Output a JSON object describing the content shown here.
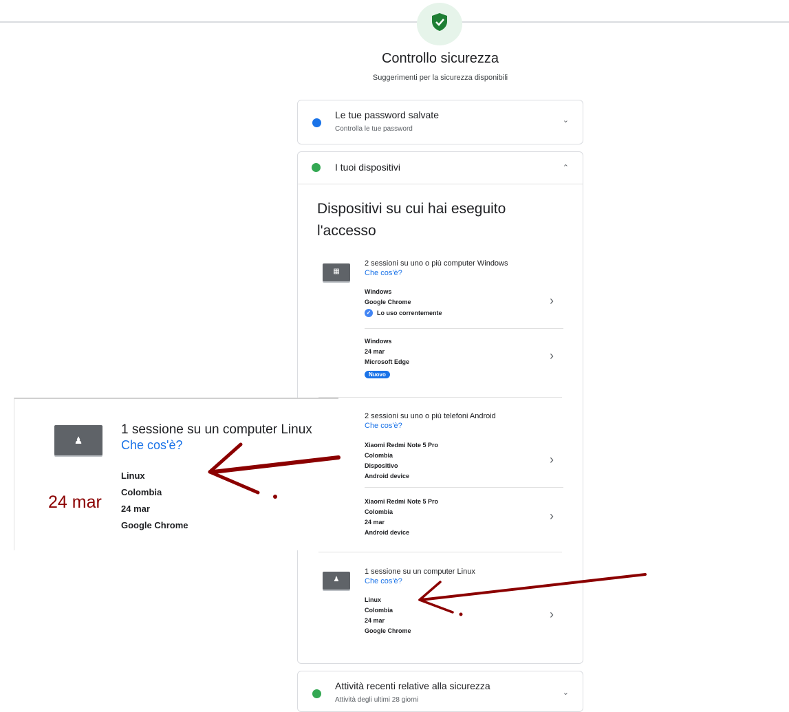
{
  "header": {
    "title": "Controllo sicurezza",
    "subtitle": "Suggerimenti per la sicurezza disponibili"
  },
  "colors": {
    "brand_blue": "#1a73e8",
    "success_green": "#34a853",
    "annotation_red": "#8b0000"
  },
  "passwords_card": {
    "title": "Le tue password salvate",
    "subtitle": "Controlla le tue password",
    "status_color": "#1a73e8",
    "chevron": "⌄"
  },
  "devices_card": {
    "title": "I tuoi dispositivi",
    "status_color": "#34a853",
    "chevron": "⌃",
    "section_title": "Dispositivi su cui hai eseguito l'accesso",
    "windows": {
      "icon": "windows-icon",
      "title": "2 sessioni su uno o più computer Windows",
      "link": "Che cos'è?",
      "sessions": [
        {
          "lines": [
            "Windows",
            "Google Chrome"
          ],
          "verified": "Lo uso correntemente"
        },
        {
          "lines": [
            "Windows",
            "24 mar",
            "Microsoft Edge"
          ],
          "badge": "Nuovo"
        }
      ]
    },
    "android": {
      "title": "2 sessioni su uno o più telefoni Android",
      "link": "Che cos'è?",
      "sessions": [
        {
          "lines": [
            "Xiaomi Redmi Note 5 Pro",
            "Colombia",
            "Dispositivo",
            "Android device"
          ]
        },
        {
          "lines": [
            "Xiaomi Redmi Note 5 Pro",
            "Colombia",
            "24 mar",
            "Android device"
          ]
        }
      ]
    },
    "linux": {
      "icon": "linux-icon",
      "title": "1 sessione su un computer Linux",
      "link": "Che cos'è?",
      "sessions": [
        {
          "lines": [
            "Linux",
            "Colombia",
            "24 mar",
            "Google Chrome"
          ]
        }
      ]
    },
    "session_chevron": "›"
  },
  "activity_card": {
    "title": "Attività recenti relative alla sicurezza",
    "subtitle": "Attività degli ultimi 28 giorni",
    "status_color": "#34a853",
    "chevron": "⌄"
  },
  "zoom_inset": {
    "title": "1 sessione su un computer Linux",
    "link": "Che cos'è?",
    "lines": [
      "Linux",
      "Colombia",
      "24 mar",
      "Google Chrome"
    ],
    "annotation": "24 mar"
  }
}
